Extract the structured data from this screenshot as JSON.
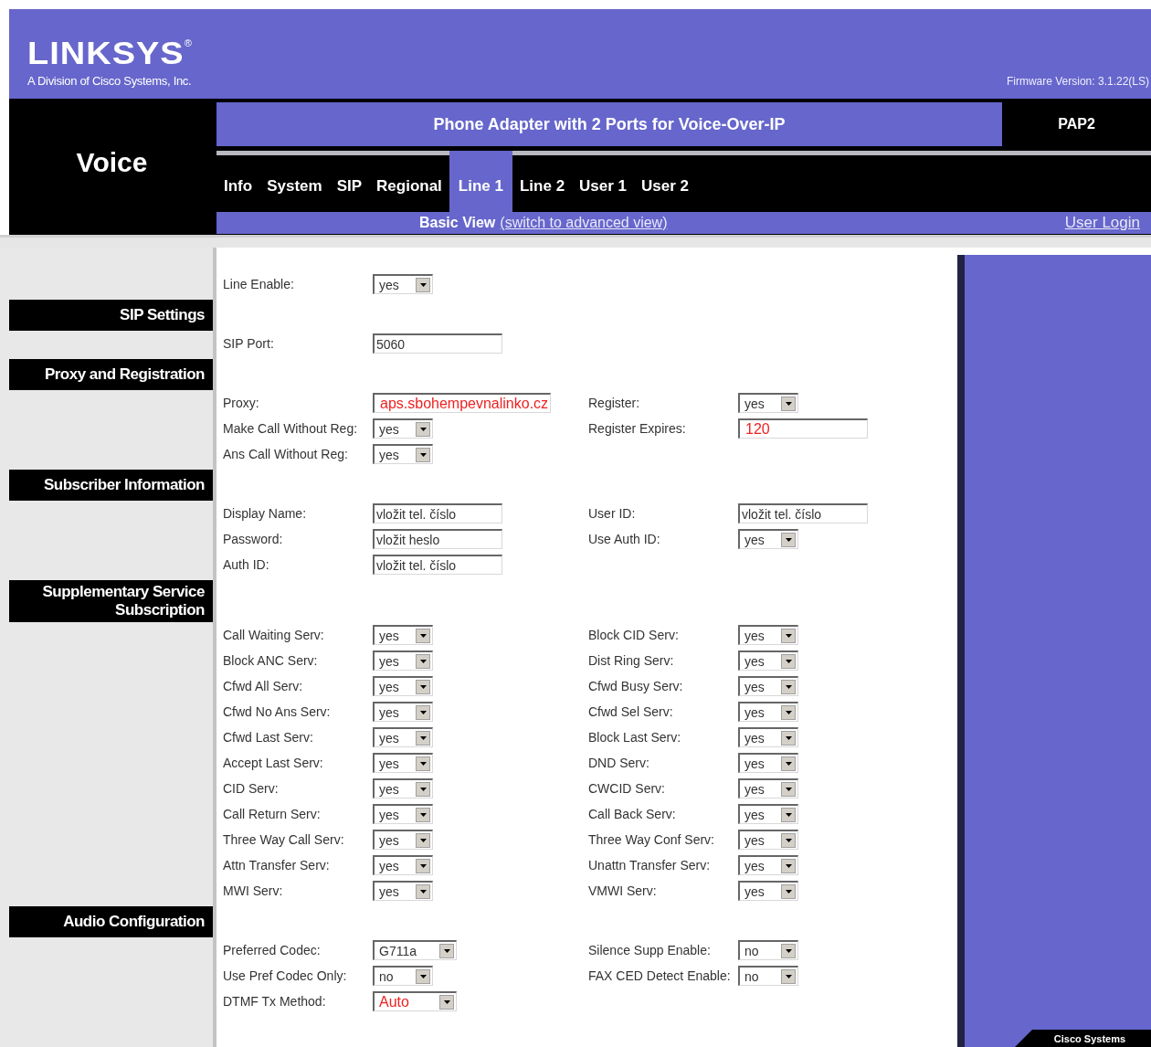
{
  "brand": {
    "logo": "LINKSYS",
    "registered": "®",
    "tagline": "A Division of Cisco Systems, Inc.",
    "firmware": "Firmware Version: 3.1.22(LS)"
  },
  "area": "Voice",
  "product": {
    "title": "Phone Adapter with 2 Ports for Voice-Over-IP",
    "model": "PAP2"
  },
  "tabs": [
    {
      "label": "Info",
      "selected": false
    },
    {
      "label": "System",
      "selected": false
    },
    {
      "label": "SIP",
      "selected": false
    },
    {
      "label": "Regional",
      "selected": false
    },
    {
      "label": "Line 1",
      "selected": true
    },
    {
      "label": "Line 2",
      "selected": false
    },
    {
      "label": "User 1",
      "selected": false
    },
    {
      "label": "User 2",
      "selected": false
    }
  ],
  "view": {
    "current": "Basic View",
    "switch_link": "(switch to advanced view)",
    "login": "User Login"
  },
  "sections": [
    {
      "rows": [
        {
          "left": {
            "label": "Line Enable:",
            "kind": "select",
            "value": "yes",
            "highlighted": false
          }
        }
      ]
    },
    {
      "title": "SIP Settings",
      "rows": [
        {
          "left": {
            "label": "SIP Port:",
            "kind": "text",
            "value": "5060",
            "highlighted": false
          }
        }
      ]
    },
    {
      "title": "Proxy and Registration",
      "rows": [
        {
          "left": {
            "label": "Proxy:",
            "kind": "text",
            "value": "aps.sbohempevnalinko.cz",
            "highlighted": true
          },
          "right": {
            "label": "Register:",
            "kind": "select",
            "value": "yes",
            "highlighted": false
          }
        },
        {
          "left": {
            "label": "Make Call Without Reg:",
            "kind": "select",
            "value": "yes",
            "highlighted": false
          },
          "right": {
            "label": "Register Expires:",
            "kind": "text",
            "value": "120",
            "highlighted": true
          }
        },
        {
          "left": {
            "label": "Ans Call Without Reg:",
            "kind": "select",
            "value": "yes",
            "highlighted": false
          }
        }
      ]
    },
    {
      "title": "Subscriber Information",
      "rows": [
        {
          "left": {
            "label": "Display Name:",
            "kind": "text",
            "value": "vložit tel. číslo",
            "highlighted": false
          },
          "right": {
            "label": "User ID:",
            "kind": "text",
            "value": "vložit tel. číslo",
            "highlighted": false
          }
        },
        {
          "left": {
            "label": "Password:",
            "kind": "text",
            "value": "vložit heslo",
            "highlighted": false
          },
          "right": {
            "label": "Use Auth ID:",
            "kind": "select",
            "value": "yes",
            "highlighted": false
          }
        },
        {
          "left": {
            "label": "Auth ID:",
            "kind": "text",
            "value": "vložit tel. číslo",
            "highlighted": false
          }
        }
      ]
    },
    {
      "title": "Supplementary Service Subscription",
      "rows": [
        {
          "left": {
            "label": "Call Waiting Serv:",
            "kind": "select",
            "value": "yes",
            "highlighted": false
          },
          "right": {
            "label": "Block CID Serv:",
            "kind": "select",
            "value": "yes",
            "highlighted": false
          }
        },
        {
          "left": {
            "label": "Block ANC Serv:",
            "kind": "select",
            "value": "yes",
            "highlighted": false
          },
          "right": {
            "label": "Dist Ring Serv:",
            "kind": "select",
            "value": "yes",
            "highlighted": false
          }
        },
        {
          "left": {
            "label": "Cfwd All Serv:",
            "kind": "select",
            "value": "yes",
            "highlighted": false
          },
          "right": {
            "label": "Cfwd Busy Serv:",
            "kind": "select",
            "value": "yes",
            "highlighted": false
          }
        },
        {
          "left": {
            "label": "Cfwd No Ans Serv:",
            "kind": "select",
            "value": "yes",
            "highlighted": false
          },
          "right": {
            "label": "Cfwd Sel Serv:",
            "kind": "select",
            "value": "yes",
            "highlighted": false
          }
        },
        {
          "left": {
            "label": "Cfwd Last Serv:",
            "kind": "select",
            "value": "yes",
            "highlighted": false
          },
          "right": {
            "label": "Block Last Serv:",
            "kind": "select",
            "value": "yes",
            "highlighted": false
          }
        },
        {
          "left": {
            "label": "Accept Last Serv:",
            "kind": "select",
            "value": "yes",
            "highlighted": false
          },
          "right": {
            "label": "DND Serv:",
            "kind": "select",
            "value": "yes",
            "highlighted": false
          }
        },
        {
          "left": {
            "label": "CID Serv:",
            "kind": "select",
            "value": "yes",
            "highlighted": false
          },
          "right": {
            "label": "CWCID Serv:",
            "kind": "select",
            "value": "yes",
            "highlighted": false
          }
        },
        {
          "left": {
            "label": "Call Return Serv:",
            "kind": "select",
            "value": "yes",
            "highlighted": false
          },
          "right": {
            "label": "Call Back Serv:",
            "kind": "select",
            "value": "yes",
            "highlighted": false
          }
        },
        {
          "left": {
            "label": "Three Way Call Serv:",
            "kind": "select",
            "value": "yes",
            "highlighted": false
          },
          "right": {
            "label": "Three Way Conf Serv:",
            "kind": "select",
            "value": "yes",
            "highlighted": false
          }
        },
        {
          "left": {
            "label": "Attn Transfer Serv:",
            "kind": "select",
            "value": "yes",
            "highlighted": false
          },
          "right": {
            "label": "Unattn Transfer Serv:",
            "kind": "select",
            "value": "yes",
            "highlighted": false
          }
        },
        {
          "left": {
            "label": "MWI Serv:",
            "kind": "select",
            "value": "yes",
            "highlighted": false
          },
          "right": {
            "label": "VMWI Serv:",
            "kind": "select",
            "value": "yes",
            "highlighted": false
          }
        }
      ]
    },
    {
      "title": "Audio Configuration",
      "rows": [
        {
          "left": {
            "label": "Preferred Codec:",
            "kind": "select",
            "value": "G711a",
            "highlighted": false
          },
          "right": {
            "label": "Silence Supp Enable:",
            "kind": "select",
            "value": "no",
            "highlighted": false
          }
        },
        {
          "left": {
            "label": "Use Pref Codec Only:",
            "kind": "select",
            "value": "no",
            "highlighted": false
          },
          "right": {
            "label": "FAX CED Detect Enable:",
            "kind": "select",
            "value": "no",
            "highlighted": false
          }
        },
        {
          "left": {
            "label": "DTMF Tx Method:",
            "kind": "select",
            "value": "Auto",
            "highlighted": true
          }
        }
      ]
    }
  ],
  "footer_badge": "Cisco Systems"
}
